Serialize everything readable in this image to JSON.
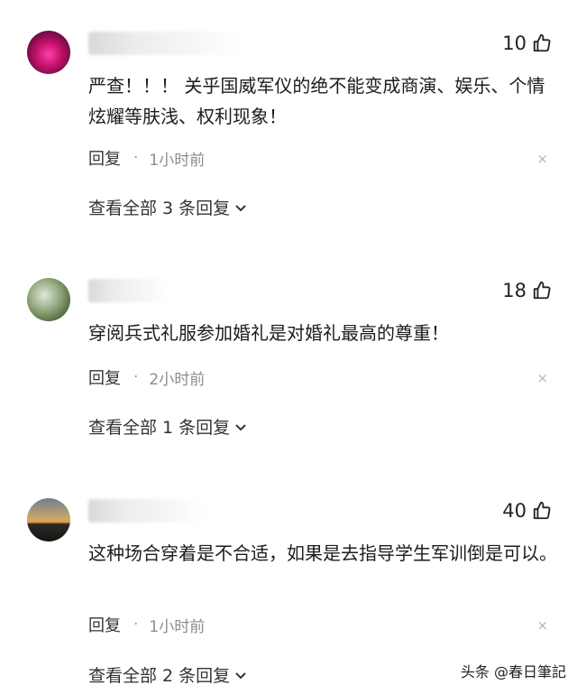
{
  "comments": [
    {
      "likes": "10",
      "text": "严查！！！ 关乎国威军仪的绝不能变成商演、娱乐、个情炫耀等肤浅、权利现象！",
      "reply_label": "回复",
      "time": "1小时前",
      "view_all": "查看全部 3 条回复"
    },
    {
      "likes": "18",
      "text": "穿阅兵式礼服参加婚礼是对婚礼最高的尊重！",
      "reply_label": "回复",
      "time": "2小时前",
      "view_all": "查看全部 1 条回复"
    },
    {
      "likes": "40",
      "text": "这种场合穿着是不合适，如果是去指导学生军训倒是可以。",
      "reply_label": "回复",
      "time": "1小时前",
      "view_all": "查看全部 2 条回复"
    }
  ],
  "dot": "·",
  "close": "×",
  "watermark": "头条 @春日筆記",
  "icons": {
    "like": "thumbs-up-icon",
    "close": "close-icon",
    "expand": "chevron-down-icon"
  }
}
